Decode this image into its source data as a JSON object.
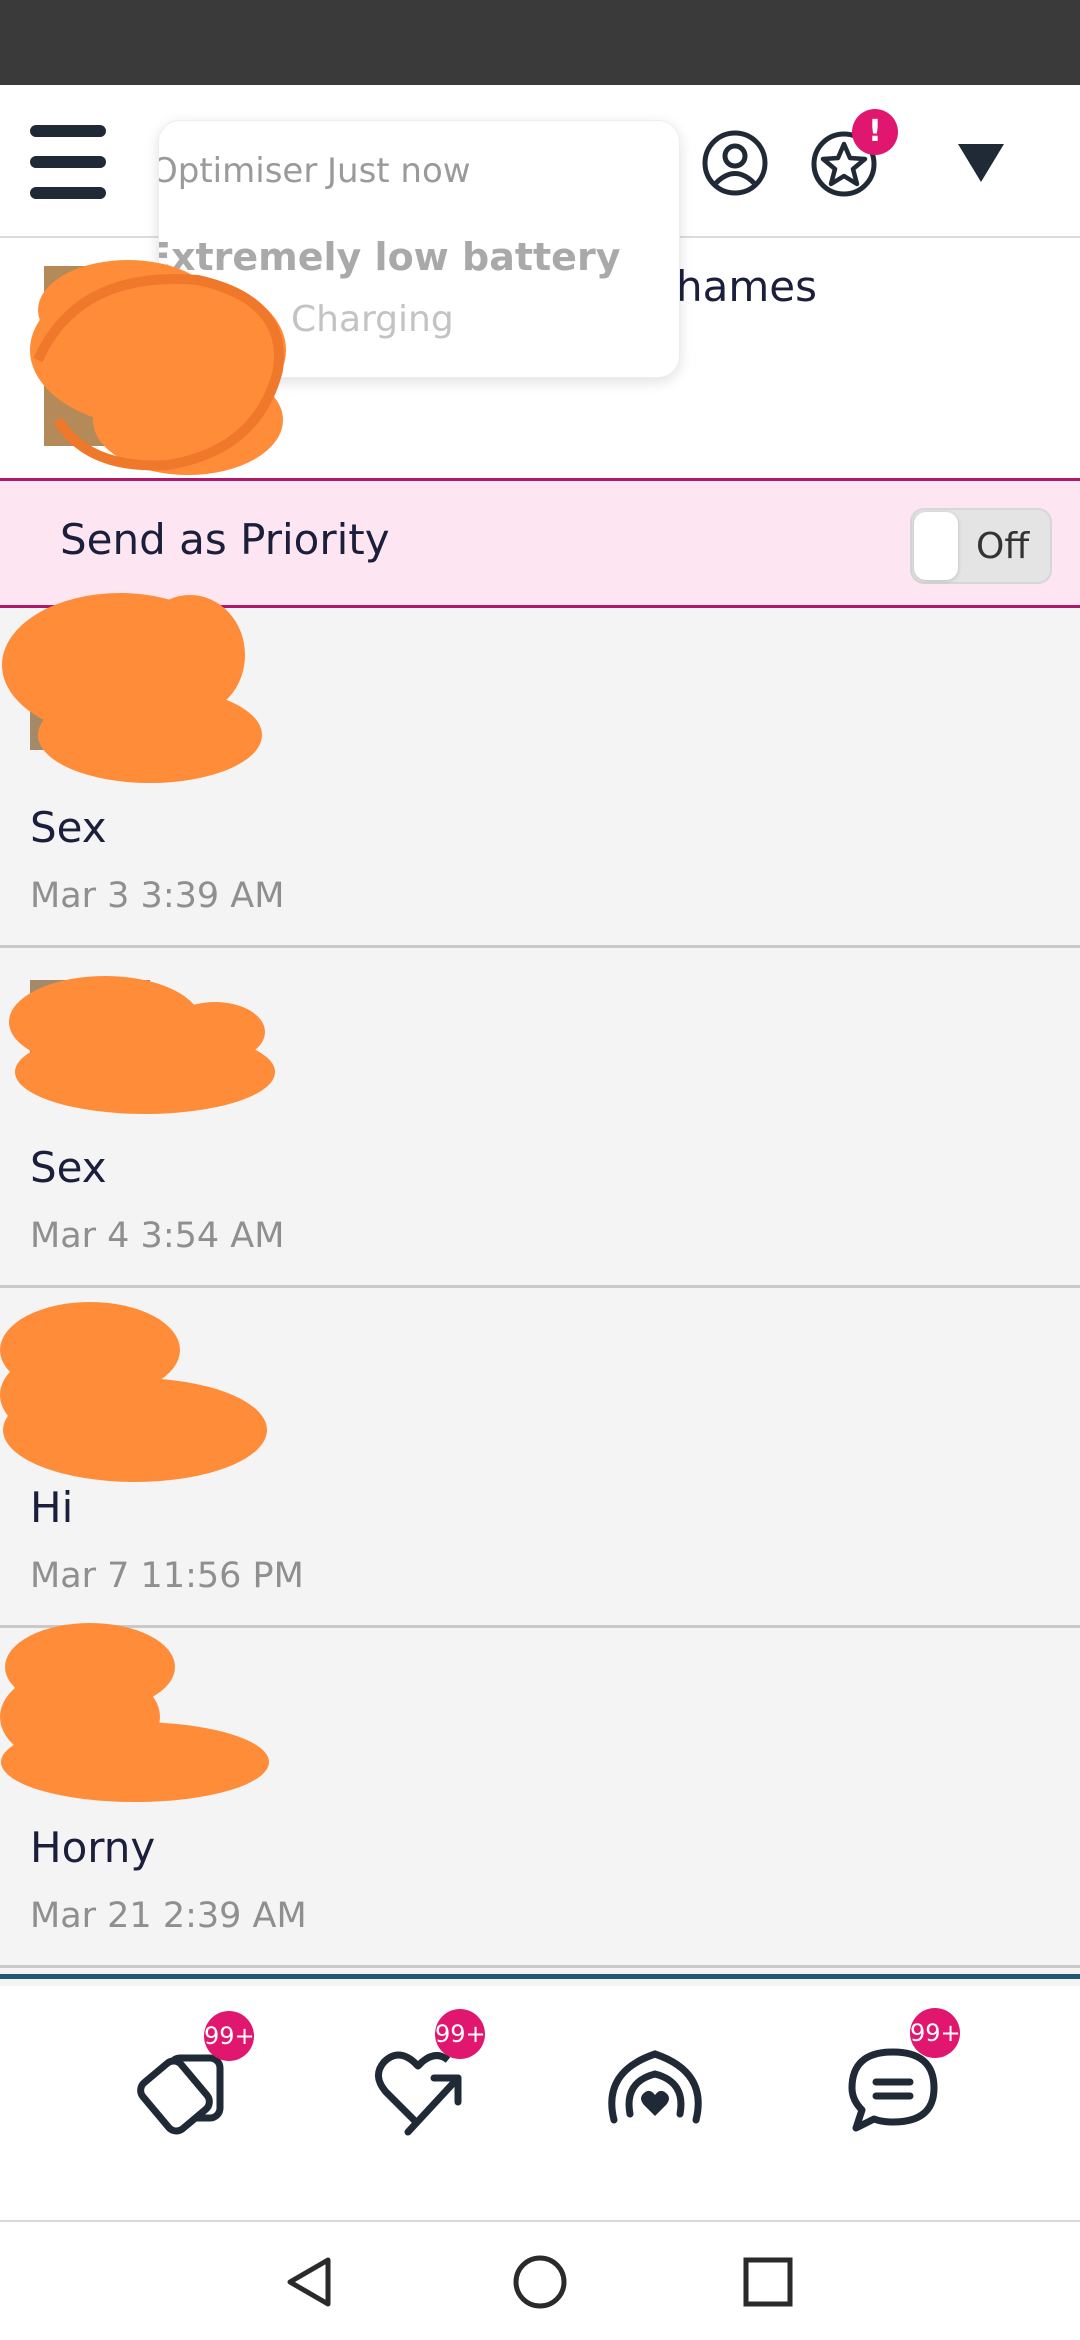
{
  "notification": {
    "app_name": "Optimiser",
    "time": "Just now",
    "title": "Extremely low battery",
    "body": "Charging"
  },
  "header": {
    "menu_icon": "hamburger-icon",
    "profile_icon": "user-circle-icon",
    "favorites_icon": "star-badge-icon",
    "favorites_badge": "!",
    "dropdown_icon": "triangle-down-icon"
  },
  "profile": {
    "name": "hames"
  },
  "priority": {
    "label": "Send as Priority",
    "toggle_state": "Off"
  },
  "messages": [
    {
      "text": "Sex",
      "time": "Mar 3 3:39 AM"
    },
    {
      "text": "Sex",
      "time": "Mar 4 3:54 AM"
    },
    {
      "text": "Hi",
      "time": "Mar 7 11:56 PM"
    },
    {
      "text": "Horny",
      "time": "Mar 21 2:39 AM"
    }
  ],
  "bottom_nav": [
    {
      "icon": "cards-icon",
      "badge": "99+"
    },
    {
      "icon": "heart-arrow-icon",
      "badge": "99+"
    },
    {
      "icon": "live-broadcast-heart-icon",
      "badge": ""
    },
    {
      "icon": "chat-bubble-icon",
      "badge": "99+"
    }
  ],
  "system_nav": [
    "back-icon",
    "home-icon",
    "recents-icon"
  ],
  "colors": {
    "accent": "#e0166f",
    "priority_bg": "#fde6f1",
    "priority_border": "#b0186a",
    "text_dark": "#1b1f3b",
    "redaction": "#ff8c38"
  }
}
